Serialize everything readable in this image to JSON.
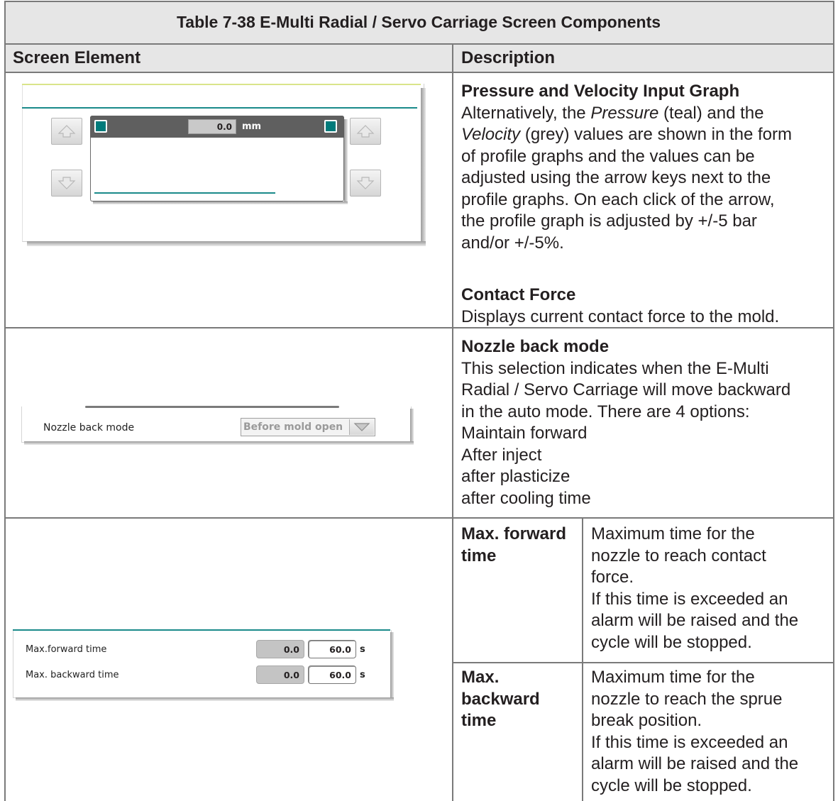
{
  "table": {
    "title": "Table 7-38 E-Multi Radial / Servo Carriage Screen Components",
    "header_left": "Screen Element",
    "header_right": "Description"
  },
  "rows": {
    "graph": {
      "heading": "Pressure and Velocity Input Graph",
      "line1_a": "Alternatively, the ",
      "line1_b": "Pressure",
      "line1_c": " (teal) and the",
      "line2_a": "Velocity",
      "line2_b": " (grey) values are shown in the form",
      "line3": "of profile graphs and the values can be",
      "line4": "adjusted using the arrow keys next to the",
      "line5": "profile graphs. On each click of the arrow,",
      "line6": "the profile graph is adjusted by +/-5 bar",
      "line7": "and/or +/-5%.",
      "contact_heading": "Contact Force",
      "contact_text": "Displays current contact force to the mold.",
      "widget": {
        "value": "0.0",
        "unit": "mm"
      }
    },
    "nozzle": {
      "heading": "Nozzle back mode",
      "line1": "This selection indicates when the E-Multi",
      "line2": "Radial / Servo Carriage will move backward",
      "line3": "in the auto mode. There are 4 options:",
      "options": [
        "Maintain forward",
        "After inject",
        "after plasticize",
        "after cooling time"
      ],
      "widget": {
        "label": "Nozzle back mode",
        "selected": "Before mold open"
      }
    },
    "times": {
      "forward_term_1": "Max. forward",
      "forward_term_2": "time",
      "forward_desc": [
        "Maximum time for the",
        "nozzle to reach contact",
        "force.",
        "If this time is exceeded an",
        "alarm will be raised and the",
        "cycle will be stopped."
      ],
      "backward_term_1": "Max.",
      "backward_term_2": "backward",
      "backward_term_3": "time",
      "backward_desc": [
        "Maximum time for the",
        "nozzle to reach the sprue",
        "break position.",
        "If this time is exceeded an",
        "alarm will be raised and the",
        "cycle will be stopped."
      ],
      "widget": {
        "forward_label": "Max.forward time",
        "forward_actual": "0.0",
        "forward_set": "60.0",
        "backward_label": "Max. backward time",
        "backward_actual": "0.0",
        "backward_set": "60.0",
        "unit": "s"
      }
    }
  }
}
